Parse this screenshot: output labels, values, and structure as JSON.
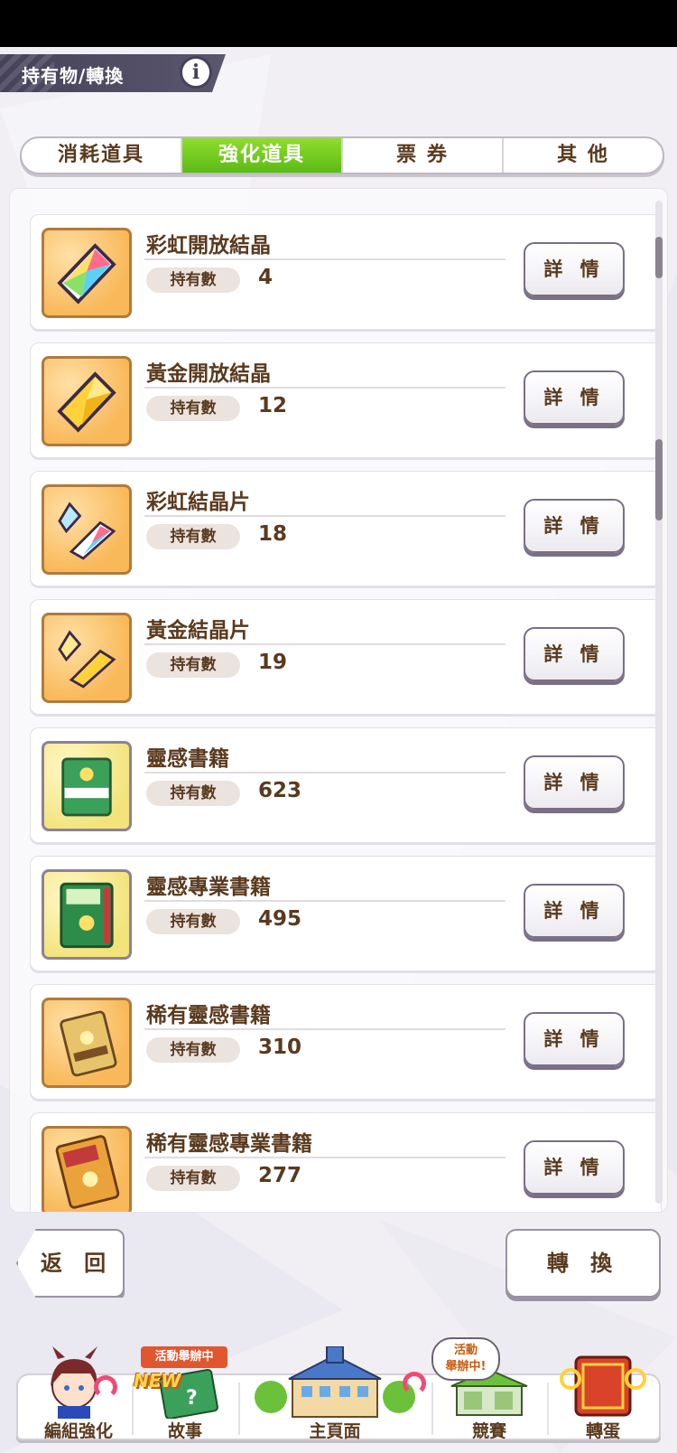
{
  "header": {
    "title": "持有物/轉換",
    "info_icon": "i"
  },
  "tabs": [
    {
      "label": "消耗道具",
      "active": false
    },
    {
      "label": "強化道具",
      "active": true
    },
    {
      "label": "票 券",
      "active": false
    },
    {
      "label": "其 他",
      "active": false
    }
  ],
  "qty_label": "持有數",
  "detail_label": "詳 情",
  "items": [
    {
      "name": "彩虹開放結晶",
      "qty": "4",
      "icon": "rainbow-crystal-icon"
    },
    {
      "name": "黃金開放結晶",
      "qty": "12",
      "icon": "gold-crystal-icon"
    },
    {
      "name": "彩虹結晶片",
      "qty": "18",
      "icon": "rainbow-shard-icon"
    },
    {
      "name": "黃金結晶片",
      "qty": "19",
      "icon": "gold-shard-icon"
    },
    {
      "name": "靈感書籍",
      "qty": "623",
      "icon": "inspiration-book-icon"
    },
    {
      "name": "靈感專業書籍",
      "qty": "495",
      "icon": "pro-inspiration-book-icon"
    },
    {
      "name": "稀有靈感書籍",
      "qty": "310",
      "icon": "rare-inspiration-book-icon"
    },
    {
      "name": "稀有靈感專業書籍",
      "qty": "277",
      "icon": "rare-pro-inspiration-book-icon"
    }
  ],
  "buttons": {
    "back": "返 回",
    "convert": "轉 換"
  },
  "nav": {
    "items": [
      {
        "label": "編組強化"
      },
      {
        "label": "故事"
      },
      {
        "label": "主頁面"
      },
      {
        "label": "競賽"
      },
      {
        "label": "轉蛋"
      }
    ],
    "event_badge": "活動舉辦中",
    "new_badge": "NEW",
    "active_badge_line1": "活動",
    "active_badge_line2": "舉辦中!"
  },
  "colors": {
    "accent_green": "#6cc61e",
    "text_brown": "#5a3a1e",
    "header_bg": "#46425a"
  }
}
